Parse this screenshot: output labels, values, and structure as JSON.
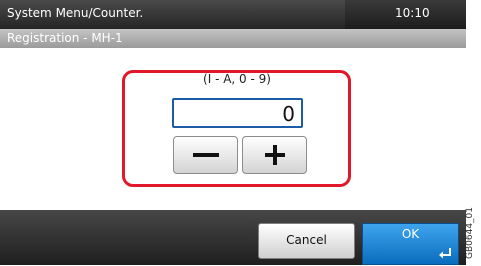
{
  "header": {
    "title": "System Menu/Counter.",
    "time": "10:10"
  },
  "subheader": {
    "title": "Registration - MH-1"
  },
  "editor": {
    "range_label": "(I - A, 0 - 9)",
    "value": "0",
    "decrement_icon": "minus-icon",
    "increment_icon": "plus-icon"
  },
  "footer": {
    "cancel_label": "Cancel",
    "ok_label": "OK",
    "enter_icon": "enter-arrow-icon"
  },
  "figure_code": "GB0644_01",
  "colors": {
    "highlight": "#e0182a",
    "ok_button": "#1480d4",
    "field_border": "#1d5ba9"
  }
}
